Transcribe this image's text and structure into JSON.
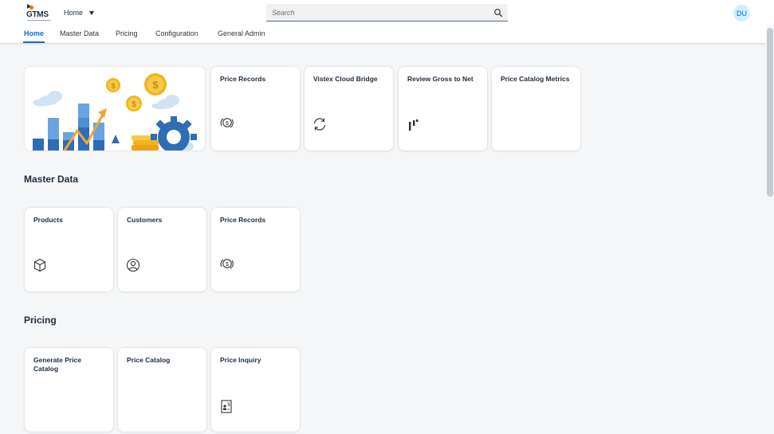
{
  "shell": {
    "logo_text": "GTMS",
    "home_label": "Home",
    "search_placeholder": "Search",
    "avatar_initials": "DU"
  },
  "tabs": [
    {
      "label": "Home",
      "active": true
    },
    {
      "label": "Master Data",
      "active": false
    },
    {
      "label": "Pricing",
      "active": false
    },
    {
      "label": "Configuration",
      "active": false
    },
    {
      "label": "General Admin",
      "active": false
    }
  ],
  "home_tiles": [
    {
      "title": "Price Records",
      "icon": "dollar-exchange-icon"
    },
    {
      "title": "Vistex Cloud Bridge",
      "icon": "refresh-icon"
    },
    {
      "title": "Review Gross to Net",
      "icon": "bar-chart-icon"
    },
    {
      "title": "Price Catalog Metrics",
      "icon": ""
    }
  ],
  "sections": {
    "master_data": {
      "title": "Master Data",
      "tiles": [
        {
          "title": "Products",
          "icon": "product-box-icon"
        },
        {
          "title": "Customers",
          "icon": "customer-icon"
        },
        {
          "title": "Price Records",
          "icon": "dollar-exchange-icon"
        }
      ]
    },
    "pricing": {
      "title": "Pricing",
      "tiles": [
        {
          "title": "Generate Price Catalog",
          "icon": ""
        },
        {
          "title": "Price Catalog",
          "icon": ""
        },
        {
          "title": "Price Inquiry",
          "icon": "price-document-icon"
        }
      ]
    }
  },
  "colors": {
    "accent": "#0a6ed1",
    "background": "#f5f6f7",
    "tile": "#ffffff",
    "illustration_blue": "#4b8fd6",
    "illustration_gold": "#f0b51c"
  }
}
